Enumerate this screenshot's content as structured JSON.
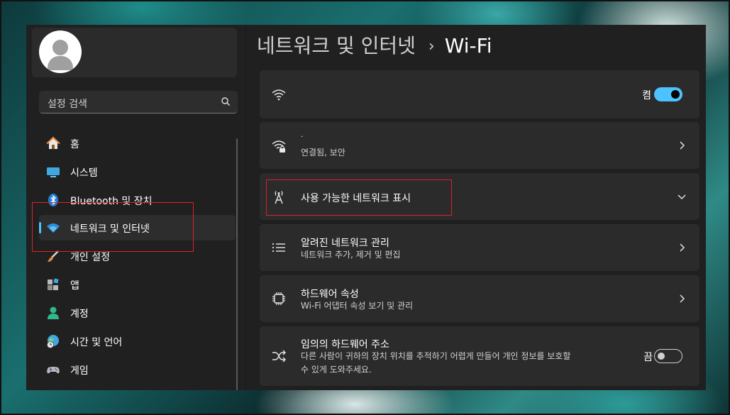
{
  "breadcrumb": {
    "parent": "네트워크 및 인터넷",
    "separator": "›",
    "current": "Wi-Fi"
  },
  "sidebar": {
    "search_placeholder": "설정 검색",
    "items": [
      {
        "label": "홈",
        "icon": "home-icon"
      },
      {
        "label": "시스템",
        "icon": "system-icon"
      },
      {
        "label": "Bluetooth 및 장치",
        "icon": "bluetooth-icon"
      },
      {
        "label": "네트워크 및 인터넷",
        "icon": "wifi-icon",
        "active": true
      },
      {
        "label": "개인 설정",
        "icon": "brush-icon"
      },
      {
        "label": "앱",
        "icon": "apps-icon"
      },
      {
        "label": "계정",
        "icon": "account-icon"
      },
      {
        "label": "시간 및 언어",
        "icon": "globe-clock-icon"
      },
      {
        "label": "게임",
        "icon": "gamepad-icon"
      }
    ]
  },
  "cards": {
    "wifi_toggle": {
      "state_label": "켬",
      "on": true
    },
    "connected": {
      "title": "·",
      "subtitle": "연결됨, 보안"
    },
    "show_networks": {
      "title": "사용 가능한 네트워크 표시"
    },
    "known_networks": {
      "title": "알려진 네트워크 관리",
      "subtitle": "네트워크 추가, 제거 및 편집"
    },
    "hardware": {
      "title": "하드웨어 속성",
      "subtitle": "Wi-Fi 어댑터 속성 보기 및 관리"
    },
    "random_hw": {
      "title": "임의의 하드웨어 주소",
      "subtitle_line1": "다른 사람이 귀하의 장치 위치를 추적하기 어렵게 만들어 개인 정보를 보호할",
      "subtitle_line2": "수 있게 도와주세요.",
      "state_label": "끔",
      "on": false
    }
  },
  "colors": {
    "accent": "#4cc2ff",
    "highlight": "#e0202a",
    "card": "#2b2b2b",
    "window": "#202020"
  }
}
